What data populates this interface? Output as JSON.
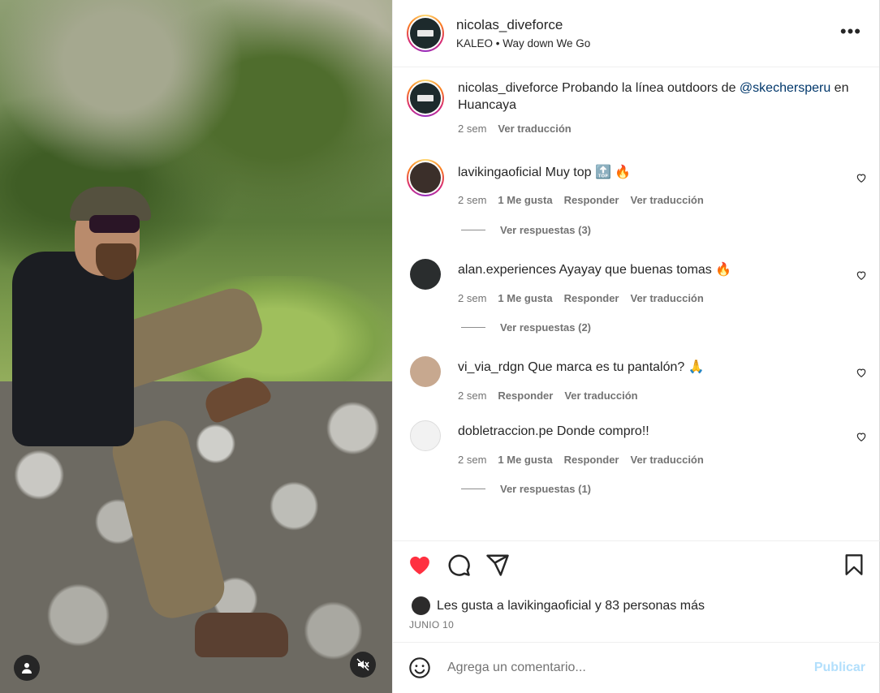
{
  "post": {
    "author": "nicolas_diveforce",
    "music": "KALEO • Way down We Go",
    "more_icon": "more-horizontal-icon"
  },
  "caption": {
    "user": "nicolas_diveforce",
    "text_before": "Probando la línea outdoors de",
    "mention": "@skechersperu",
    "text_after": "en Huancaya",
    "time": "2 sem",
    "translate": "Ver traducción"
  },
  "comments": [
    {
      "user": "lavikingaoficial",
      "text": "Muy top 🔝 🔥",
      "time": "2 sem",
      "likes": "1 Me gusta",
      "reply": "Responder",
      "translate": "Ver traducción",
      "replies": "Ver respuestas (3)"
    },
    {
      "user": "alan.experiences",
      "text": "Ayayay que buenas tomas 🔥",
      "time": "2 sem",
      "likes": "1 Me gusta",
      "reply": "Responder",
      "translate": "Ver traducción",
      "replies": "Ver respuestas (2)"
    },
    {
      "user": "vi_via_rdgn",
      "text": "Que marca es tu pantalón? 🙏",
      "time": "2 sem",
      "reply": "Responder",
      "translate": "Ver traducción"
    },
    {
      "user": "dobletraccion.pe",
      "text": "Donde compro!!",
      "time": "2 sem",
      "likes": "1 Me gusta",
      "reply": "Responder",
      "translate": "Ver traducción",
      "replies": "Ver respuestas (1)"
    }
  ],
  "likes": {
    "prefix": "Les gusta a",
    "user": "lavikingaoficial",
    "middle": "y",
    "others": "83 personas más"
  },
  "date": "JUNIO 10",
  "composer": {
    "placeholder": "Agrega un comentario...",
    "publish": "Publicar"
  },
  "colors": {
    "like_red": "#ff3040",
    "link_blue": "#00376b",
    "publish_disabled": "#b2dffc"
  }
}
